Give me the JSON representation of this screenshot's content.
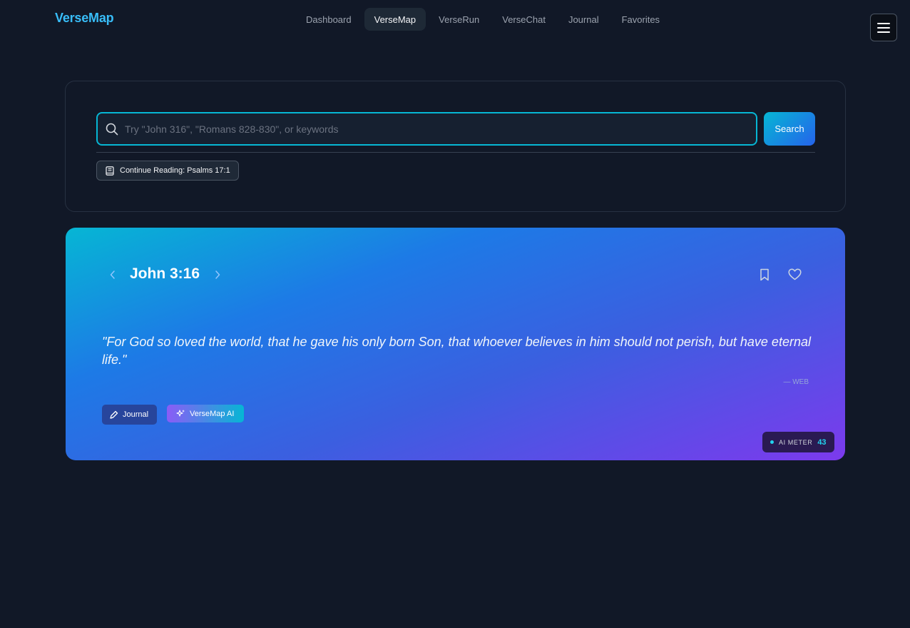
{
  "header": {
    "logo": "VerseMap",
    "nav": [
      {
        "label": "Dashboard",
        "active": false
      },
      {
        "label": "VerseMap",
        "active": true
      },
      {
        "label": "VerseRun",
        "active": false
      },
      {
        "label": "VerseChat",
        "active": false
      },
      {
        "label": "Journal",
        "active": false
      },
      {
        "label": "Favorites",
        "active": false
      }
    ],
    "menu_icon": "hamburger-icon"
  },
  "search": {
    "placeholder": "Try \"John 316\", \"Romans 828-830\", or keywords",
    "value": "",
    "button_label": "Search",
    "continue_label": "Continue Reading: Psalms 17:1"
  },
  "verse": {
    "reference": "John 3:16",
    "text": "\"For God so loved the world, that he gave his only born Son, that whoever believes in him should not perish, but have eternal life.\"",
    "translation": "— WEB",
    "journal_label": "Journal",
    "ai_label": "VerseMap AI",
    "ai_meter_label": "AI METER",
    "ai_meter_value": "43"
  },
  "colors": {
    "background": "#111827",
    "accent": "#06b6d4",
    "logo": "#38bdf8",
    "gradient_start": "#06b6d4",
    "gradient_end": "#7c3aed"
  }
}
